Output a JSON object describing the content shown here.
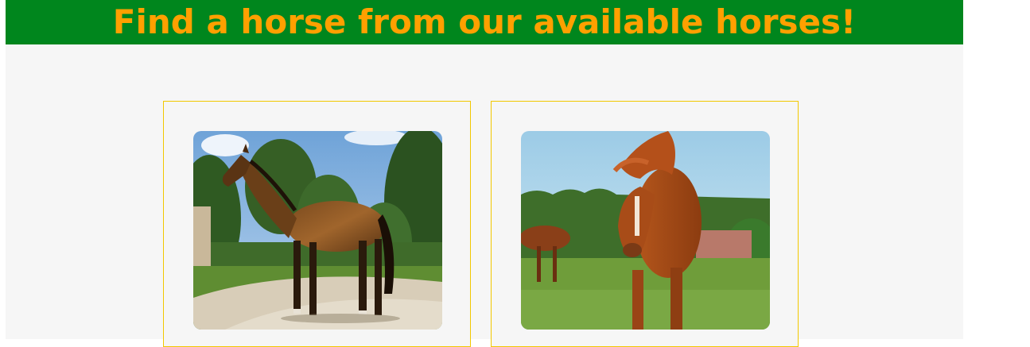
{
  "header": {
    "title": "Find a horse from our available horses!"
  },
  "colors": {
    "header_bg": "#00861d",
    "title_text": "#ffa000",
    "card_border": "#f2c800",
    "page_bg": "#f6f6f6"
  },
  "horses": [
    {
      "image_subject": "bay-horse-photo"
    },
    {
      "image_subject": "chestnut-horse-photo"
    }
  ]
}
